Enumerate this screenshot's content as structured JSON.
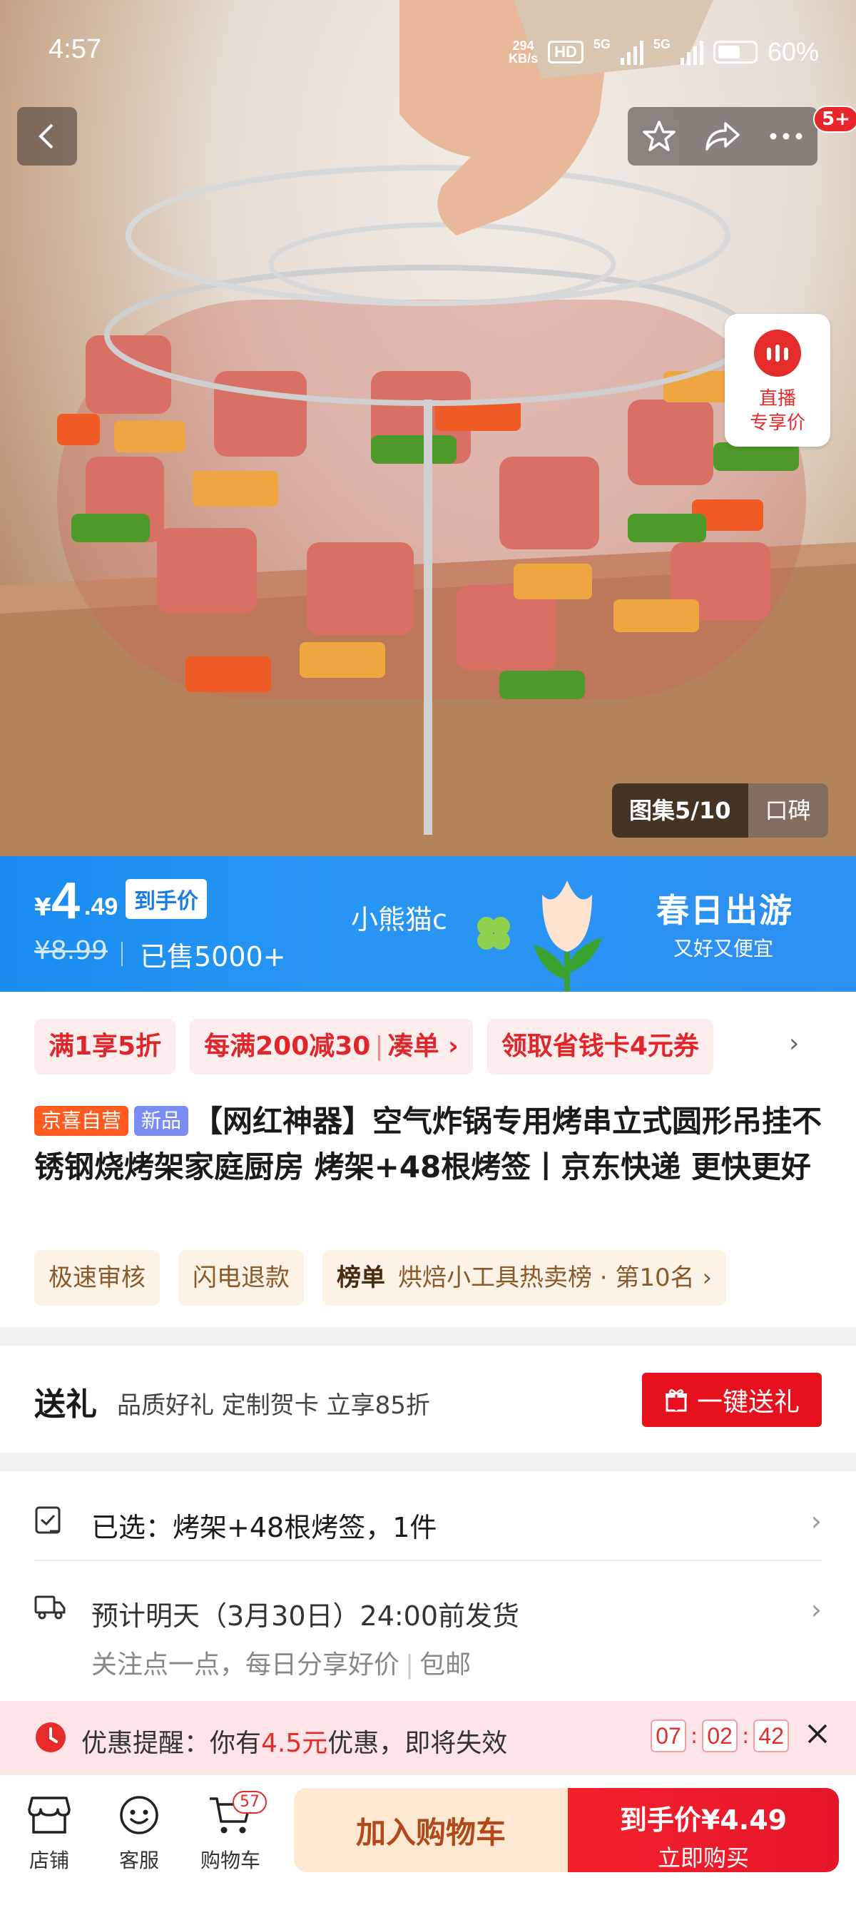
{
  "status_bar": {
    "time": "4:57",
    "net_speed_value": "294",
    "net_speed_unit": "KB/s",
    "hd_label": "HD",
    "sim1": "5G",
    "sim2": "5G",
    "battery": "60%"
  },
  "header": {
    "notification_badge": "5+"
  },
  "live": {
    "line1": "直播",
    "line2": "专享价"
  },
  "gallery": {
    "counter": "图集5/10",
    "reviews_tab": "口碑"
  },
  "price_banner": {
    "currency": "¥",
    "price_int": "4",
    "price_dec": ".49",
    "price_tag": "到手价",
    "original_price": "¥8.99",
    "sold": "已售5000+",
    "user": "小熊猫c",
    "promo_title": "春日出游",
    "promo_sub": "又好又便宜"
  },
  "coupons": [
    {
      "main": "满1享5折"
    },
    {
      "main": "每满200减30",
      "action": "凑单 ›"
    },
    {
      "main": "领取省钱卡4元券"
    }
  ],
  "coupon_more": "›",
  "product": {
    "tag_self": "京喜自营",
    "tag_new": "新品",
    "title": "【网红神器】空气炸锅专用烤串立式圆形吊挂不锈钢烧烤架家庭厨房 烤架+48根烤签丨京东快递 更快更好"
  },
  "chips": [
    {
      "text": "极速审核"
    },
    {
      "text": "闪电退款"
    },
    {
      "bold": "榜单",
      "text": "烘焙小工具热卖榜 · 第10名 ›"
    }
  ],
  "gift": {
    "title": "送礼",
    "desc": "品质好礼 定制贺卡 立享85折",
    "button": "一键送礼"
  },
  "selection": {
    "text": "已选：烤架+48根烤签，1件"
  },
  "shipping": {
    "text": "预计明天（3月30日）24:00前发货",
    "sub1": "关注点一点，每日分享好价",
    "sub2": "包邮"
  },
  "reminder": {
    "prefix": "优惠提醒：你有",
    "amount": "4.5元",
    "suffix": "优惠，即将失效",
    "hh": "07",
    "mm": "02",
    "ss": "42"
  },
  "bottom_nav": {
    "shop": "店铺",
    "service": "客服",
    "cart": "购物车",
    "cart_count": "57",
    "add_to_cart": "加入购物车",
    "buy_price_label": "到手价¥4.49",
    "buy_now": "立即购买"
  },
  "colors": {
    "accent_red": "#e62b2b",
    "banner_blue": "#1a8cf0",
    "chip_bg": "#fcf2e6",
    "coupon_bg": "#fdecec"
  }
}
